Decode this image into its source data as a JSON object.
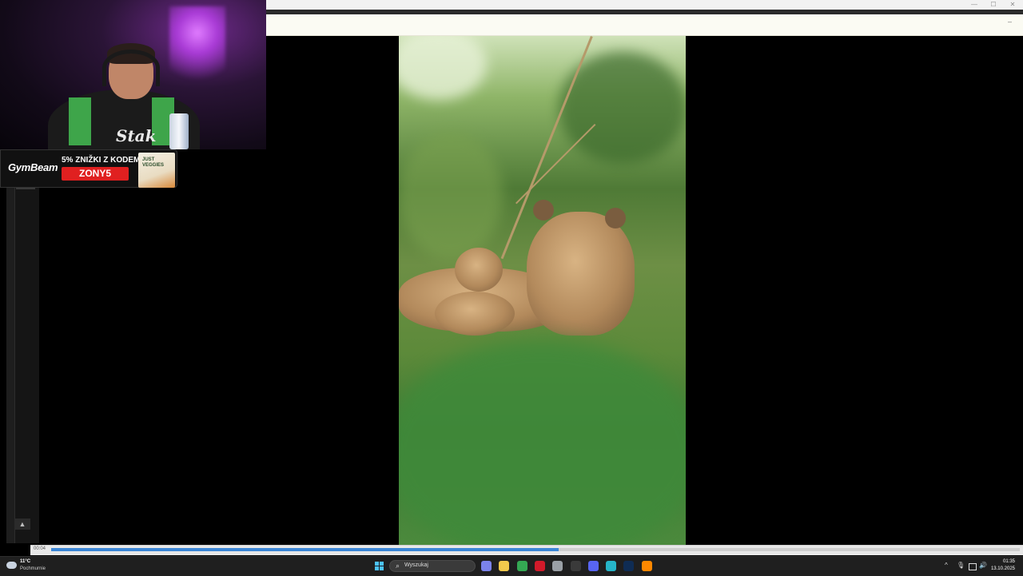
{
  "browser": {
    "minimize_glyph": "—",
    "maximize_glyph": "☐",
    "close_glyph": "✕",
    "notification_close_glyph": "–"
  },
  "overlay": {
    "jersey_text": "Stak"
  },
  "ad": {
    "brand": "GymBeam",
    "promo": "5% ZNIŽKI Z KODEM",
    "code": "ZONY5",
    "product": "JUST VEGGIES"
  },
  "player": {
    "elapsed": "00:04",
    "progress": 0.524,
    "scroll_up_glyph": "▲"
  },
  "taskbar": {
    "weather": {
      "temp": "11°C",
      "condition": "Pochmurnie"
    },
    "search_placeholder": "Wyszukaj",
    "search_glyph": "⌕",
    "tray": {
      "chevron": "^",
      "mic": "🎙",
      "speaker": "🔊"
    },
    "clock": {
      "time": "01:35",
      "date": "13.10.2025"
    },
    "apps": [
      {
        "name": "teams-icon",
        "color": "#7b83eb"
      },
      {
        "name": "file-explorer-icon",
        "color": "#f2c94c"
      },
      {
        "name": "chrome-icon",
        "color": "#34a853"
      },
      {
        "name": "opera-icon",
        "color": "#d11a2a"
      },
      {
        "name": "settings-icon",
        "color": "#9aa0a6"
      },
      {
        "name": "xbox-icon",
        "color": "#3a3a3a"
      },
      {
        "name": "discord-icon",
        "color": "#5865f2"
      },
      {
        "name": "notes-icon",
        "color": "#26b5c9"
      },
      {
        "name": "lightroom-icon",
        "color": "#0f2c54"
      },
      {
        "name": "vlc-icon",
        "color": "#ff8800"
      }
    ]
  }
}
